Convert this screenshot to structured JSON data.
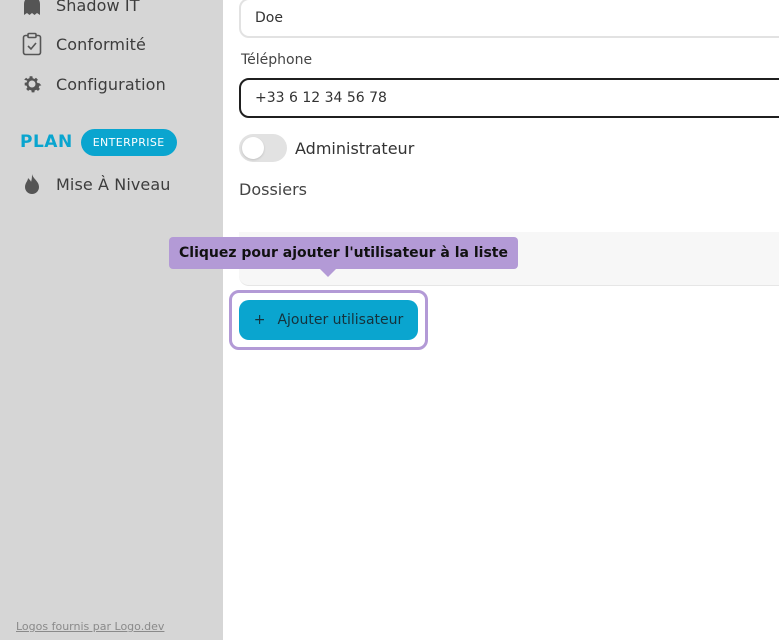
{
  "sidebar": {
    "items": [
      {
        "label": "Shadow IT",
        "icon": "ghost-icon"
      },
      {
        "label": "Conformité",
        "icon": "clipboard-check-icon"
      },
      {
        "label": "Configuration",
        "icon": "gear-icon"
      }
    ],
    "plan": {
      "title": "PLAN",
      "badge": "ENTERPRISE"
    },
    "upgrade": {
      "label": "Mise À Niveau",
      "icon": "flame-icon"
    },
    "footer_link": "Logos fournis par Logo.dev"
  },
  "form": {
    "last_name_value": "Doe",
    "phone_label": "Téléphone",
    "phone_value": "+33 6 12 34 56 78",
    "admin_label": "Administrateur",
    "admin_enabled": false,
    "folders_title": "Dossiers",
    "add_button_label": "Ajouter utilisateur",
    "add_button_icon": "+"
  },
  "tooltip": {
    "text": "Cliquez pour ajouter l'utilisateur à la liste"
  },
  "colors": {
    "accent": "#0aa5cf",
    "tooltip": "#b39ad6",
    "sidebar_bg": "#d6d6d6"
  }
}
